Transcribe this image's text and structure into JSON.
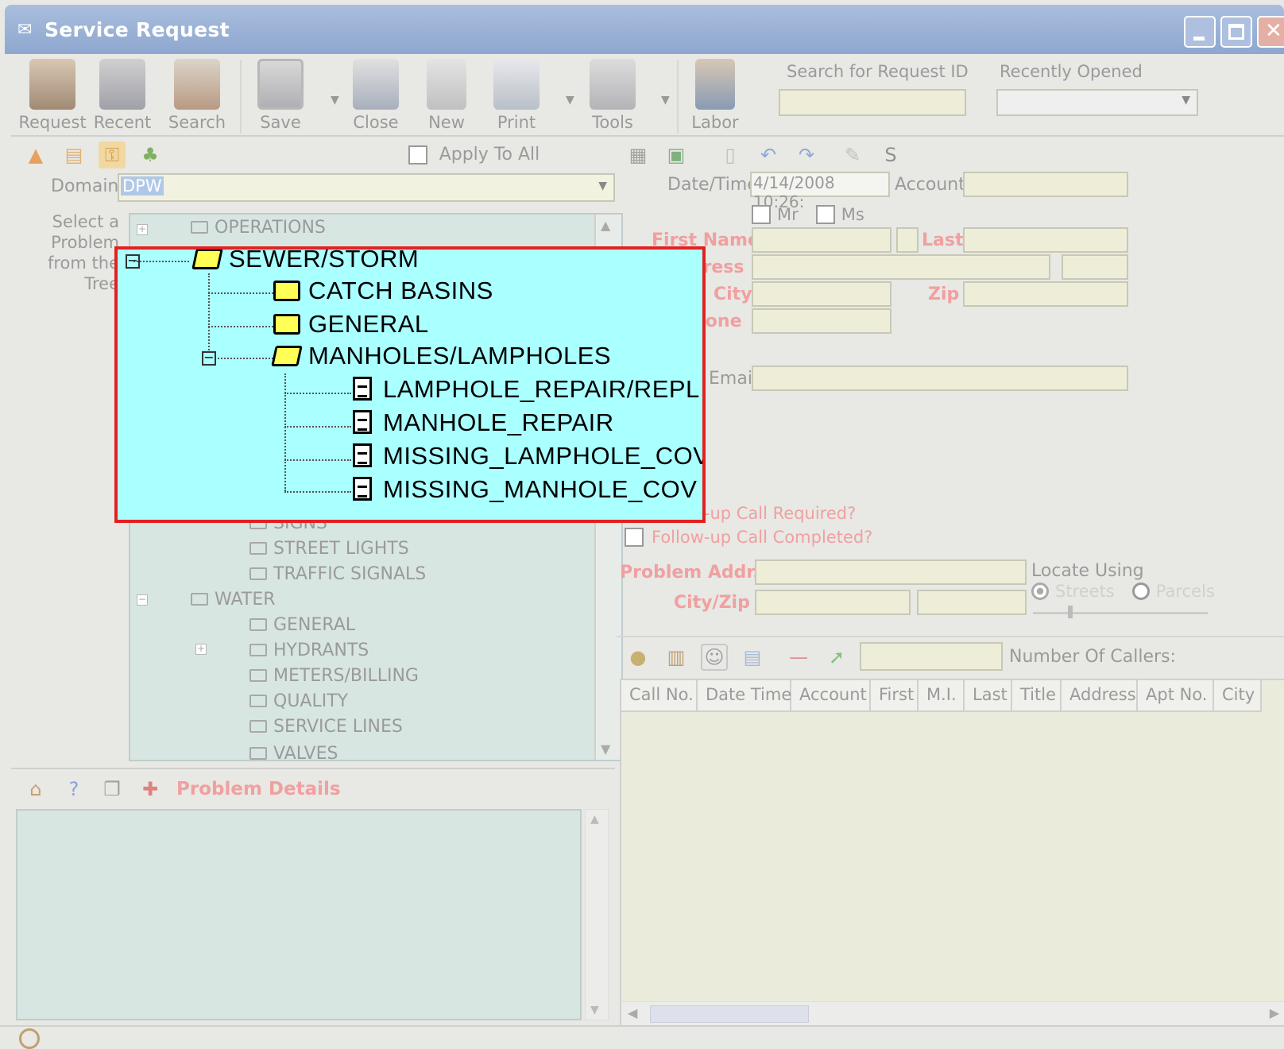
{
  "window": {
    "title": "Service Request"
  },
  "toolbar": {
    "request": "Request",
    "recent": "Recent",
    "search": "Search",
    "save": "Save",
    "close": "Close",
    "new": "New",
    "print": "Print",
    "tools": "Tools",
    "labor": "Labor",
    "search_id_label": "Search for Request ID",
    "recently_opened_label": "Recently Opened"
  },
  "left": {
    "apply_to_all": "Apply To All",
    "domain_label": "Domain",
    "domain_value": "DPW",
    "select_label_1": "Select a",
    "select_label_2": "Problem",
    "select_label_3": "from the",
    "select_label_4": "Tree"
  },
  "tree": {
    "operations": "OPERATIONS",
    "signs": "SIGNS",
    "street_lights": "STREET LIGHTS",
    "traffic_signals": "TRAFFIC SIGNALS",
    "water": "WATER",
    "general": "GENERAL",
    "hydrants": "HYDRANTS",
    "meters_billing": "METERS/BILLING",
    "quality": "QUALITY",
    "service_lines": "SERVICE LINES",
    "valves": "VALVES"
  },
  "highlight": {
    "sewer_storm": "SEWER/STORM",
    "catch_basins": "CATCH BASINS",
    "general": "GENERAL",
    "manholes_lampholes": "MANHOLES/LAMPHOLES",
    "lamphole_repair": "LAMPHOLE_REPAIR/REPL",
    "manhole_repair": "MANHOLE_REPAIR",
    "missing_lamphole": "MISSING_LAMPHOLE_COV",
    "missing_manhole": "MISSING_MANHOLE_COV"
  },
  "problem_details": {
    "title": "Problem Details"
  },
  "form": {
    "datetime_label": "Date/Time",
    "datetime_value": "4/14/2008 10:26:",
    "account_label": "Account",
    "mr": "Mr",
    "ms": "Ms",
    "first_name": "First Name",
    "last": "Last",
    "address": "Address",
    "city": "City",
    "zip": "Zip",
    "phone": "Phone",
    "email": "Email",
    "followup_required": "Follow-up Call Required?",
    "followup_completed": "Follow-up Call Completed?",
    "problem_addr": "Problem Addr.",
    "city_zip": "City/Zip",
    "locate_using": "Locate Using",
    "streets": "Streets",
    "parcels": "Parcels",
    "number_of_callers": "Number Of Callers:"
  },
  "grid": {
    "columns": [
      "Call No.",
      "Date Time",
      "Account",
      "First",
      "M.I.",
      "Last",
      "Title",
      "Address",
      "Apt No.",
      "City"
    ]
  },
  "colors": {
    "highlight_bg": "#aaffff",
    "highlight_border": "#e32020",
    "required_label": "#f0a0a0"
  }
}
